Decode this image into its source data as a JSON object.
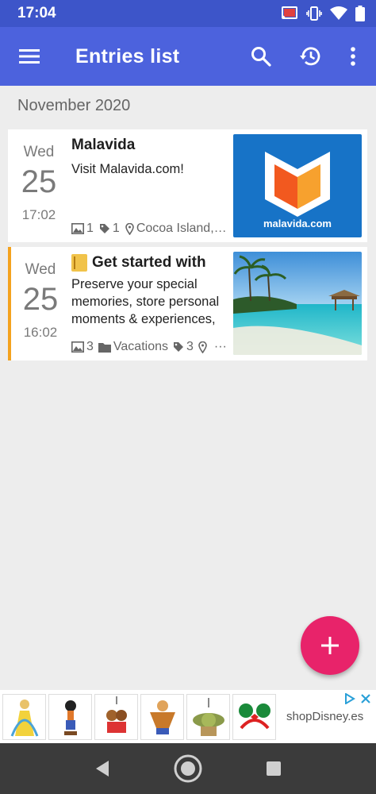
{
  "status_bar": {
    "time": "17:04"
  },
  "app_bar": {
    "title": "Entries list",
    "icons": [
      "menu-icon",
      "search-icon",
      "history-icon",
      "more-vert-icon"
    ]
  },
  "section": {
    "month": "November 2020"
  },
  "entries": [
    {
      "dow": "Wed",
      "day": "25",
      "time": "17:02",
      "title": "Malavida",
      "text": "Visit Malavida.com!",
      "meta": {
        "photos": "1",
        "tags": "1",
        "location": "Cocoa Island,…"
      },
      "thumb_caption": "malavida.com"
    },
    {
      "dow": "Wed",
      "day": "25",
      "time": "16:02",
      "title": "Get started with",
      "text": "Preserve your special memories, store personal moments & experiences,",
      "meta": {
        "photos": "3",
        "folder": "Vacations",
        "tags": "3",
        "more": "···"
      },
      "accent": "#f4a21e"
    }
  ],
  "fab": {
    "icon": "add-icon",
    "color": "#e8236a"
  },
  "ad": {
    "brand": "shopDisney.es"
  },
  "colors": {
    "status_bar": "#3d55c9",
    "app_bar": "#4c62dd",
    "background": "#ededed"
  }
}
